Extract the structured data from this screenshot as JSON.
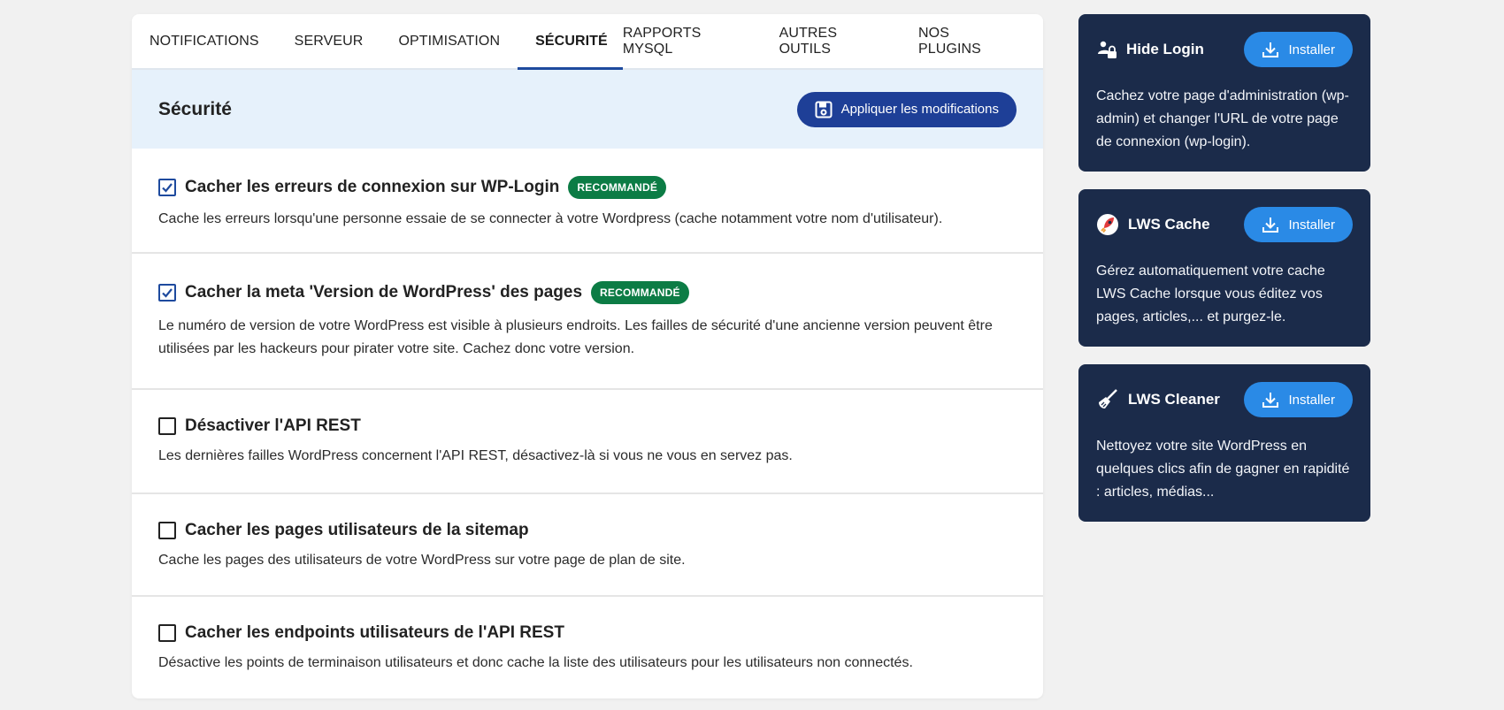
{
  "tabs": [
    {
      "label": "NOTIFICATIONS"
    },
    {
      "label": "SERVEUR"
    },
    {
      "label": "OPTIMISATION"
    },
    {
      "label": "SÉCURITÉ"
    },
    {
      "label": "RAPPORTS MYSQL"
    },
    {
      "label": "AUTRES OUTILS"
    },
    {
      "label": "NOS PLUGINS"
    }
  ],
  "section": {
    "title": "Sécurité",
    "apply_label": "Appliquer les modifications"
  },
  "options": [
    {
      "title": "Cacher les erreurs de connexion sur WP-Login",
      "badge": "RECOMMANDÉ",
      "checked": true,
      "desc": "Cache les erreurs lorsqu'une personne essaie de se connecter à votre Wordpress (cache notamment votre nom d'utilisateur)."
    },
    {
      "title": "Cacher la meta 'Version de WordPress' des pages",
      "badge": "RECOMMANDÉ",
      "checked": true,
      "desc": "Le numéro de version de votre WordPress est visible à plusieurs endroits. Les failles de sécurité d'une ancienne version peuvent être utilisées par les hackeurs pour pirater votre site. Cachez donc votre version."
    },
    {
      "title": "Désactiver l'API REST",
      "checked": false,
      "desc": "Les dernières failles WordPress concernent l'API REST, désactivez-là si vous ne vous en servez pas."
    },
    {
      "title": "Cacher les pages utilisateurs de la sitemap",
      "checked": false,
      "desc": "Cache les pages des utilisateurs de votre WordPress sur votre page de plan de site."
    },
    {
      "title": "Cacher les endpoints utilisateurs de l'API REST",
      "checked": false,
      "desc": "Désactive les points de terminaison utilisateurs et donc cache la liste des utilisateurs pour les utilisateurs non connectés."
    }
  ],
  "plugins": [
    {
      "name": "Hide Login",
      "icon": "lock-user-icon",
      "install_label": "Installer",
      "desc": "Cachez votre page d'administration (wp-admin) et changer l'URL de votre page de connexion (wp-login)."
    },
    {
      "name": "LWS Cache",
      "icon": "rocket-icon",
      "install_label": "Installer",
      "desc": "Gérez automatiquement votre cache LWS Cache lorsque vous éditez vos pages, articles,... et purgez-le."
    },
    {
      "name": "LWS Cleaner",
      "icon": "broom-icon",
      "install_label": "Installer",
      "desc": "Nettoyez votre site WordPress en quelques clics afin de gagner en rapidité : articles, médias..."
    }
  ],
  "colors": {
    "primary": "#1e3f97",
    "accent_blue": "#2a8ae6",
    "badge_green": "#0c7c45",
    "sidebar_bg": "#1b2b4a",
    "header_bg": "#e6f1fb"
  }
}
